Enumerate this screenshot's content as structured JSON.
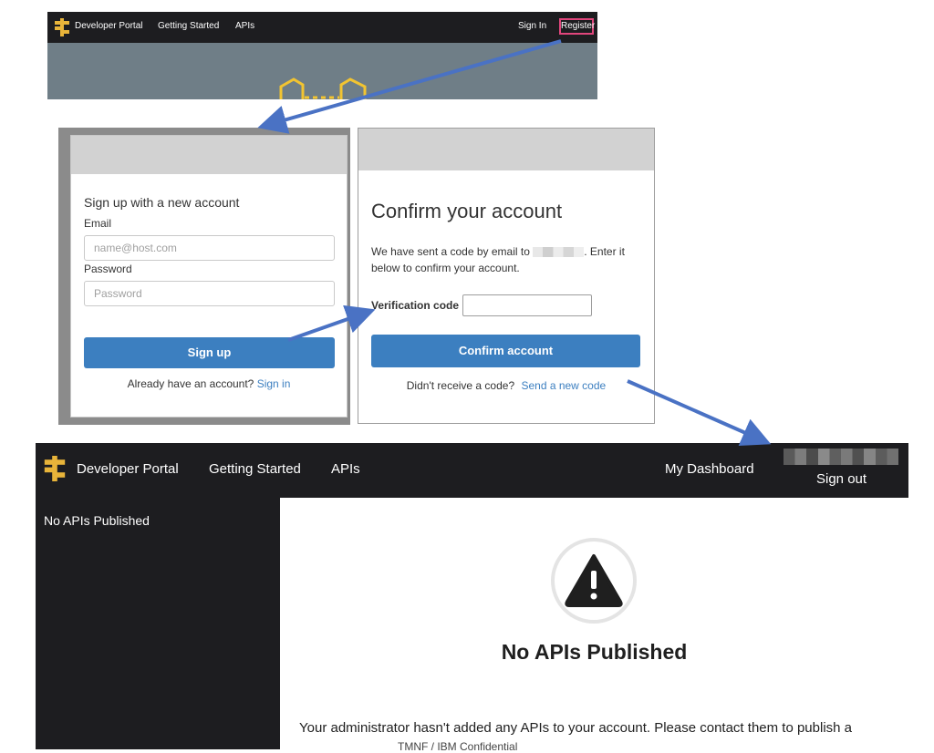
{
  "portal_top": {
    "brand": "Developer Portal",
    "nav": [
      "Getting Started",
      "APIs"
    ],
    "sign_in": "Sign In",
    "register": "Register"
  },
  "signup": {
    "heading": "Sign up with a new account",
    "email_label": "Email",
    "email_placeholder": "name@host.com",
    "password_label": "Password",
    "password_placeholder": "Password",
    "submit": "Sign up",
    "already_text": "Already have an account?",
    "sign_in_link": "Sign in"
  },
  "confirm": {
    "title": "Confirm your account",
    "desc_before": "We have sent a code by email to",
    "desc_after": ". Enter it below to confirm your account.",
    "verification_label": "Verification code",
    "submit": "Confirm account",
    "resend_text": "Didn't receive a code?",
    "resend_link": "Send a new code"
  },
  "dashboard": {
    "brand": "Developer Portal",
    "nav": [
      "Getting Started",
      "APIs"
    ],
    "my_dashboard": "My Dashboard",
    "sign_out": "Sign out",
    "sidebar_text": "No APIs Published",
    "empty_title": "No APIs Published",
    "empty_message": "Your administrator hasn't added any APIs to your account. Please contact them to publish a"
  },
  "footer_note": "TMNF / IBM Confidential",
  "colors": {
    "nav_bg": "#1d1d20",
    "primary": "#3c7fc0",
    "highlight": "#e0467c",
    "logo": "#e8b43a",
    "arrow": "#4a72c4"
  }
}
